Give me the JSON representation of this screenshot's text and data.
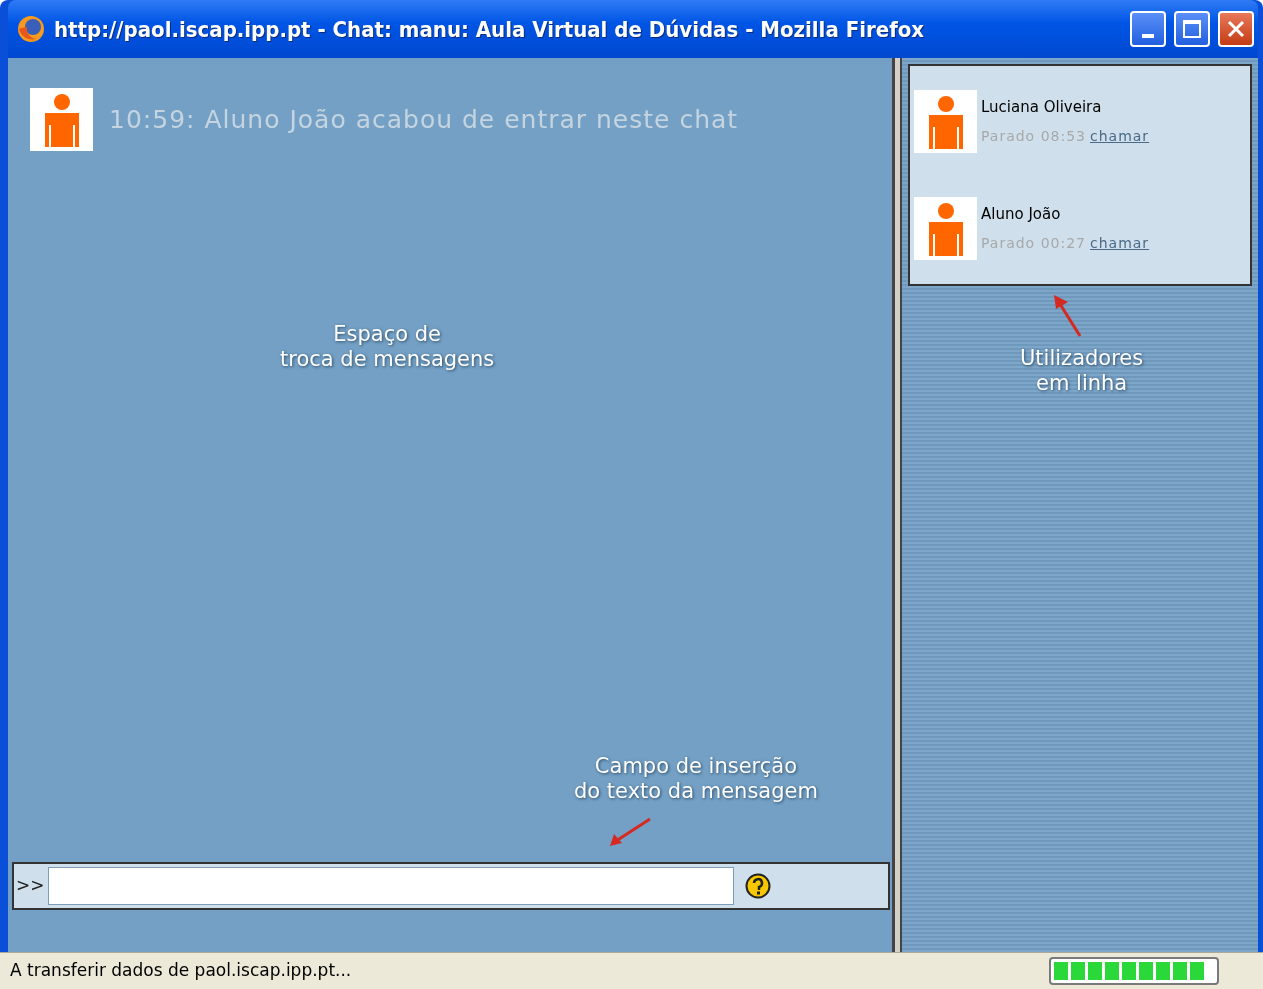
{
  "window": {
    "title": "http://paol.iscap.ipp.pt - Chat: manu: Aula Virtual de Dúvidas - Mozilla Firefox"
  },
  "messages": [
    {
      "text": "10:59: Aluno João acabou de entrar neste chat"
    }
  ],
  "input": {
    "prompt": ">>"
  },
  "users": [
    {
      "name": "Luciana Oliveira",
      "status": "Parado 08:53",
      "action": "chamar"
    },
    {
      "name": "Aluno João",
      "status": "Parado 00:27",
      "action": "chamar"
    }
  ],
  "annotations": [
    {
      "text": "Espaço de\ntroca de mensagens",
      "kind": "messages"
    },
    {
      "text": "Campo de inserção\ndo texto da mensagem",
      "kind": "input"
    },
    {
      "text": "Utilizadores\nem linha",
      "kind": "users"
    }
  ],
  "status_bar": {
    "text": "A transferir dados de paol.iscap.ipp.pt...",
    "level": 0.95
  }
}
